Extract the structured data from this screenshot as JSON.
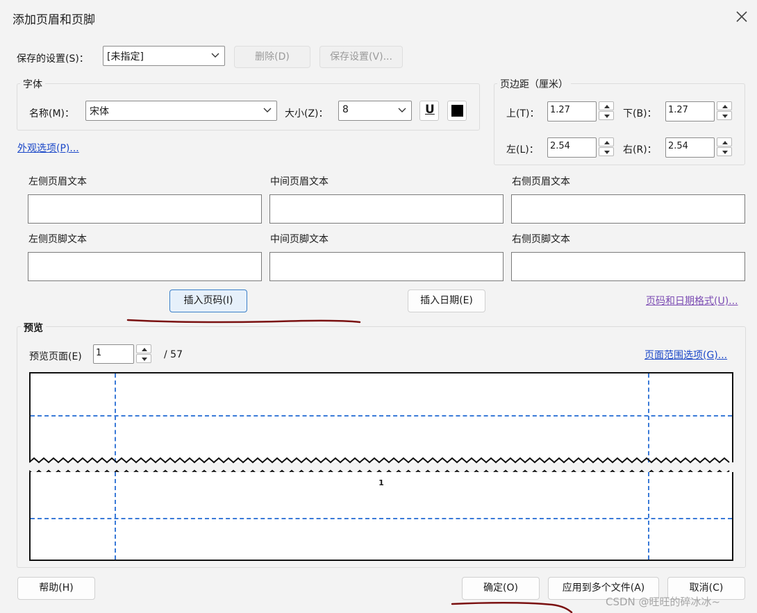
{
  "window": {
    "title": "添加页眉和页脚"
  },
  "saved_settings": {
    "label": "保存的设置(S)：",
    "value": "[未指定]",
    "delete_label": "删除(D)",
    "save_label": "保存设置(V)..."
  },
  "font": {
    "group_label": "字体",
    "name_label": "名称(M)：",
    "name_value": "宋体",
    "size_label": "大小(Z)：",
    "size_value": "8",
    "underline_glyph": "U",
    "color": "#000000"
  },
  "margins": {
    "group_label": "页边距（厘米）",
    "top_label": "上(T)：",
    "top_value": "1.27",
    "bottom_label": "下(B)：",
    "bottom_value": "1.27",
    "left_label": "左(L)：",
    "left_value": "2.54",
    "right_label": "右(R)：",
    "right_value": "2.54"
  },
  "appearance_link": "外观选项(P)...",
  "header_fields": {
    "left_label": "左侧页眉文本",
    "center_label": "中间页眉文本",
    "right_label": "右侧页眉文本"
  },
  "footer_fields": {
    "left_label": "左侧页脚文本",
    "center_label": "中间页脚文本",
    "right_label": "右侧页脚文本"
  },
  "insert": {
    "page_number_label": "插入页码(I)",
    "date_label": "插入日期(E)",
    "format_link": "页码和日期格式(U)..."
  },
  "preview": {
    "group_label": "预览",
    "page_label": "预览页面(E)",
    "page_value": "1",
    "total": "/ 57",
    "range_link": "页面范围选项(G)...",
    "footer_page_number": "1"
  },
  "footer_buttons": {
    "help_label": "帮助(H)",
    "ok_label": "确定(O)",
    "apply_multiple_label": "应用到多个文件(A)",
    "cancel_label": "取消(C)"
  },
  "watermark": "CSDN @旺旺的碎冰冰~",
  "colors": {
    "link": "#1a47c8",
    "guide": "#3a7ad8",
    "annotation": "#7a1010",
    "primary_border": "#3a7fc8"
  }
}
